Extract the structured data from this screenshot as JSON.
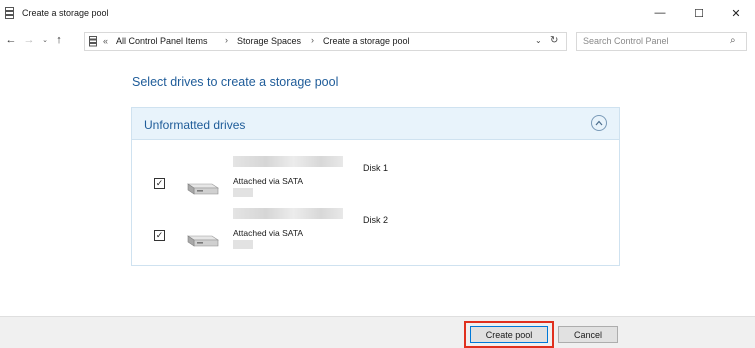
{
  "window": {
    "title": "Create a storage pool",
    "icon": "storage-spaces-icon",
    "controls": {
      "minimize": "—",
      "maximize": "☐",
      "close": "✕"
    }
  },
  "nav": {
    "back": "←",
    "forward": "→",
    "recent": "⌄",
    "up": "↑"
  },
  "address": {
    "overflow": "«",
    "crumbs": [
      "All Control Panel Items",
      "Storage Spaces",
      "Create a storage pool"
    ],
    "separator": "›",
    "dropdown": "⌄",
    "refresh": "↻"
  },
  "search": {
    "placeholder": "Search Control Panel",
    "icon": "⌕"
  },
  "main": {
    "heading": "Select drives to create a storage pool",
    "panel": {
      "title": "Unformatted drives",
      "collapse_glyph": "⌃",
      "drives": [
        {
          "checked": "✓",
          "connection": "Attached via SATA",
          "disk": "Disk 1"
        },
        {
          "checked": "✓",
          "connection": "Attached via SATA",
          "disk": "Disk 2"
        }
      ]
    }
  },
  "footer": {
    "create_label": "Create pool",
    "cancel_label": "Cancel"
  },
  "colors": {
    "accent": "#1f5c99",
    "panel_header": "#e8f3fb",
    "highlight": "#e0301e"
  }
}
